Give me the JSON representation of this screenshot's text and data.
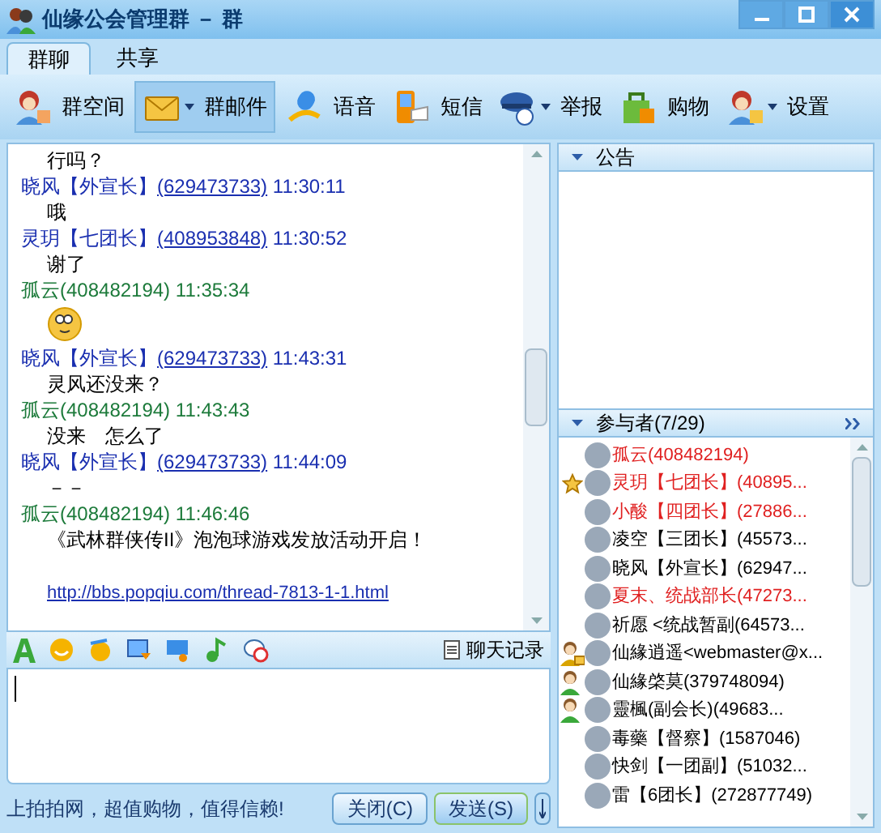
{
  "window": {
    "title": "仙缘公会管理群 － 群"
  },
  "tabs": [
    {
      "label": "群聊",
      "selected": true
    },
    {
      "label": "共享",
      "selected": false
    }
  ],
  "toolbar": [
    {
      "label": "群空间",
      "kind": "space",
      "dropdown": false,
      "selected": false
    },
    {
      "label": "群邮件",
      "kind": "mail",
      "dropdown": true,
      "selected": true
    },
    {
      "label": "语音",
      "kind": "voice",
      "dropdown": false,
      "selected": false
    },
    {
      "label": "短信",
      "kind": "sms",
      "dropdown": false,
      "selected": false
    },
    {
      "label": "举报",
      "kind": "police",
      "dropdown": true,
      "selected": false
    },
    {
      "label": "购物",
      "kind": "shop",
      "dropdown": false,
      "selected": false
    },
    {
      "label": "设置",
      "kind": "settings",
      "dropdown": true,
      "selected": false
    }
  ],
  "messages": [
    {
      "body": [
        {
          "kind": "text",
          "text": "行吗？"
        }
      ]
    },
    {
      "sender": {
        "name": "晓风【外宣长】",
        "qq": "(629473733)",
        "time": "11:30:11",
        "self": false
      },
      "body": [
        {
          "kind": "text",
          "text": "哦"
        }
      ]
    },
    {
      "sender": {
        "name": "灵玥【七团长】",
        "qq": "(408953848)",
        "time": "11:30:52",
        "self": false
      },
      "body": [
        {
          "kind": "text",
          "text": "谢了"
        }
      ]
    },
    {
      "sender": {
        "name": "孤云",
        "qq": "(408482194)",
        "time": "11:35:34",
        "self": true
      },
      "body": [
        {
          "kind": "emoji"
        }
      ]
    },
    {
      "sender": {
        "name": "晓风【外宣长】",
        "qq": "(629473733)",
        "time": "11:43:31",
        "self": false
      },
      "body": [
        {
          "kind": "text",
          "text": "灵风还没来？"
        }
      ]
    },
    {
      "sender": {
        "name": "孤云",
        "qq": "(408482194)",
        "time": "11:43:43",
        "self": true
      },
      "body": [
        {
          "kind": "text",
          "text": "没来　怎么了"
        }
      ]
    },
    {
      "sender": {
        "name": "晓风【外宣长】",
        "qq": "(629473733)",
        "time": "11:44:09",
        "self": false
      },
      "body": [
        {
          "kind": "text",
          "text": "－－"
        }
      ]
    },
    {
      "sender": {
        "name": "孤云",
        "qq": "(408482194)",
        "time": "11:46:46",
        "self": true
      },
      "body": [
        {
          "kind": "text",
          "text": "《武林群侠传II》泡泡球游戏发放活动开启！"
        },
        {
          "kind": "link",
          "text": "http://bbs.popqiu.com/thread-7813-1-1.html"
        }
      ]
    }
  ],
  "input_toolbar": {
    "history": "聊天记录"
  },
  "notice": {
    "title": "公告"
  },
  "members": {
    "title": "参与者(7/29)",
    "items": [
      {
        "name": "孤云(408482194)",
        "highlight": true,
        "kind": "plain"
      },
      {
        "name": "灵玥【七团长】(40895...",
        "highlight": true,
        "kind": "star"
      },
      {
        "name": "小酸【四团长】(27886...",
        "highlight": true,
        "kind": "plain"
      },
      {
        "name": "凌空【三团长】(45573...",
        "highlight": false,
        "kind": "plain"
      },
      {
        "name": "晓风【外宣长】(62947...",
        "highlight": false,
        "kind": "plain"
      },
      {
        "name": "夏末、统战部长(47273...",
        "highlight": true,
        "kind": "plain"
      },
      {
        "name": "祈愿 <统战暂副(64573...",
        "highlight": false,
        "kind": "plain"
      },
      {
        "name": "仙緣逍遥<webmaster@x...",
        "highlight": false,
        "kind": "owner"
      },
      {
        "name": "仙緣棨莫(379748094)",
        "highlight": false,
        "kind": "admin"
      },
      {
        "name": "靈楓(副会长)(49683...",
        "highlight": false,
        "kind": "admin"
      },
      {
        "name": "毒藥【督察】(1587046)",
        "highlight": false,
        "kind": "plain"
      },
      {
        "name": "快剑【一团副】(51032...",
        "highlight": false,
        "kind": "plain"
      },
      {
        "name": "雷【6团长】(272877749)",
        "highlight": false,
        "kind": "plain"
      }
    ]
  },
  "status_bar": {
    "ad": "上拍拍网，超值购物，值得信赖!",
    "buttons": [
      "关闭(C)",
      "发送(S)"
    ]
  }
}
